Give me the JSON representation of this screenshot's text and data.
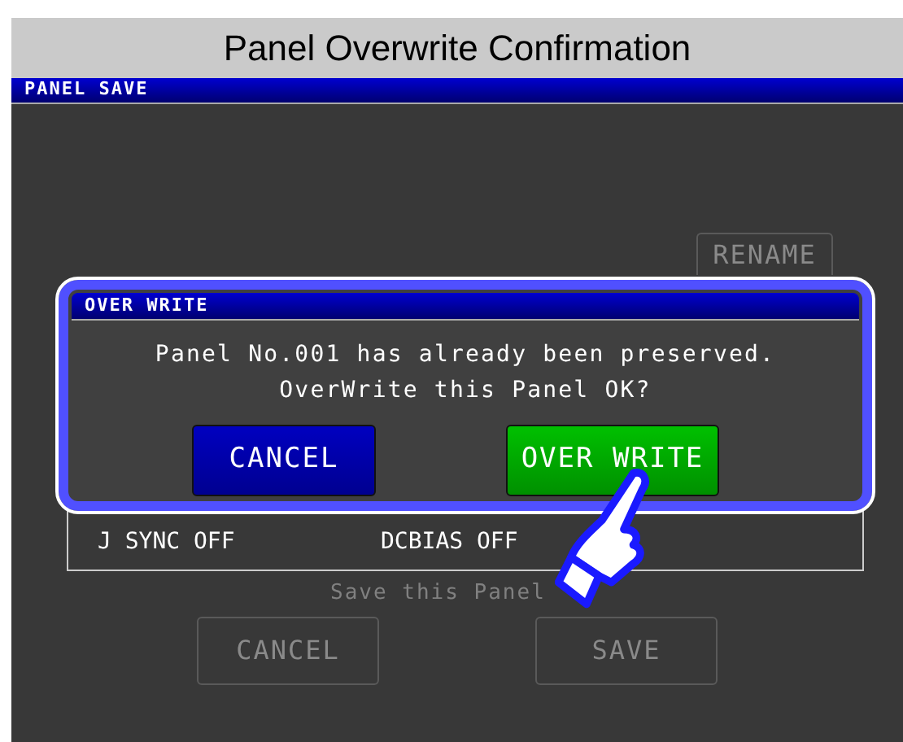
{
  "caption": "Panel Overwrite Confirmation",
  "screen": {
    "title": "PANEL SAVE",
    "rename_button": {
      "label": "RENAME",
      "disabled": true
    },
    "settings": [
      {
        "label": "J SYNC OFF"
      },
      {
        "label": "DCBIAS OFF"
      }
    ],
    "prompt": {
      "text": "Save this Panel",
      "disabled": true
    },
    "buttons": [
      {
        "label": "CANCEL",
        "disabled": true
      },
      {
        "label": "SAVE",
        "disabled": true
      }
    ]
  },
  "dialog": {
    "title": "OVER WRITE",
    "message": [
      "Panel No.001 has already been preserved.",
      "OverWrite this Panel OK?"
    ],
    "buttons": [
      {
        "label": "CANCEL",
        "kind": "cancel"
      },
      {
        "label": "OVER WRITE",
        "kind": "confirm"
      }
    ]
  }
}
